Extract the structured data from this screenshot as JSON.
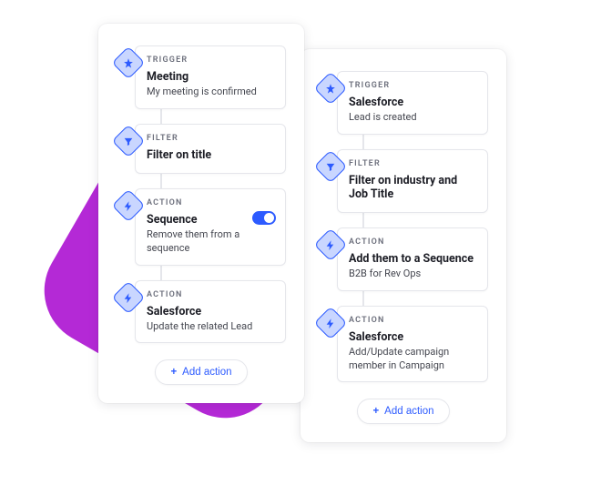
{
  "colors": {
    "accent": "#2D5BFF",
    "bgshape": "#B429D6"
  },
  "left": {
    "steps": [
      {
        "kind": "TRIGGER",
        "icon": "star-icon",
        "title": "Meeting",
        "sub": "My meeting is confirmed"
      },
      {
        "kind": "FILTER",
        "icon": "filter-icon",
        "title": "Filter on title",
        "sub": ""
      },
      {
        "kind": "ACTION",
        "icon": "bolt-icon",
        "title": "Sequence",
        "sub": "Remove them from a sequence",
        "toggle": true
      },
      {
        "kind": "ACTION",
        "icon": "bolt-icon",
        "title": "Salesforce",
        "sub": "Update the related Lead"
      }
    ],
    "add": "Add action"
  },
  "right": {
    "steps": [
      {
        "kind": "TRIGGER",
        "icon": "star-icon",
        "title": "Salesforce",
        "sub": "Lead is created"
      },
      {
        "kind": "FILTER",
        "icon": "filter-icon",
        "title": "Filter on industry and Job Title",
        "sub": ""
      },
      {
        "kind": "ACTION",
        "icon": "bolt-icon",
        "title": "Add them to a Sequence",
        "sub": "B2B for Rev Ops"
      },
      {
        "kind": "ACTION",
        "icon": "bolt-icon",
        "title": "Salesforce",
        "sub": "Add/Update campaign member in Campaign"
      }
    ],
    "add": "Add action"
  }
}
